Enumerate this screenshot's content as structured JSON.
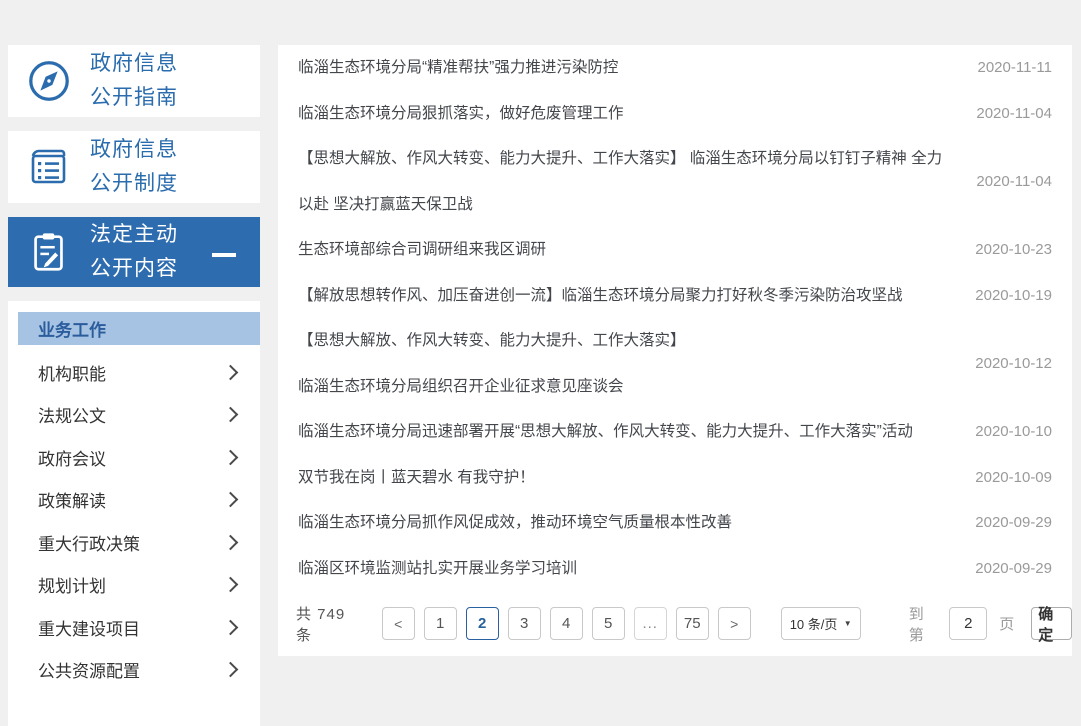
{
  "colors": {
    "accent_blue": "#2e6cb0",
    "sidebar_text_blue": "#2a6cad",
    "menu_highlight_bg": "#a6c3e3",
    "menu_highlight_text": "#2b5c9c",
    "title_text": "#43464b",
    "date_text": "#9a9a9a",
    "pager_active_blue": "#29609f",
    "page_background": "#f0f0f0"
  },
  "sidebar": {
    "cards": [
      {
        "label": "政府信息\n公开指南",
        "icon": "compass-icon"
      },
      {
        "label": "政府信息\n公开制度",
        "icon": "ledger-icon"
      },
      {
        "label": "法定主动\n公开内容",
        "icon": "clipboard-pencil-icon",
        "state_icon": "minus-icon"
      }
    ],
    "menu": {
      "items": [
        {
          "label": "业务工作",
          "active": true
        },
        {
          "label": "机构职能"
        },
        {
          "label": "法规公文"
        },
        {
          "label": "政府会议"
        },
        {
          "label": "政策解读"
        },
        {
          "label": "重大行政决策"
        },
        {
          "label": "规划计划"
        },
        {
          "label": "重大建设项目"
        },
        {
          "label": "公共资源配置"
        }
      ]
    }
  },
  "list": {
    "rows": [
      {
        "title": "临淄生态环境分局“精准帮扶”强力推进污染防控",
        "date": "2020-11-11"
      },
      {
        "title": "临淄生态环境分局狠抓落实，做好危废管理工作",
        "date": "2020-11-04"
      },
      {
        "title": "【思想大解放、作风大转变、能力大提升、工作大落实】 临淄生态环境分局以钉钉子精神 全力\n以赴 坚决打赢蓝天保卫战",
        "date": "2020-11-04"
      },
      {
        "title": "生态环境部综合司调研组来我区调研",
        "date": "2020-10-23"
      },
      {
        "title": "【解放思想转作风、加压奋进创一流】临淄生态环境分局聚力打好秋冬季污染防治攻坚战",
        "date": "2020-10-19"
      },
      {
        "title": "【思想大解放、作风大转变、能力大提升、工作大落实】\n临淄生态环境分局组织召开企业征求意见座谈会",
        "date": "2020-10-12"
      },
      {
        "title": "临淄生态环境分局迅速部署开展“思想大解放、作风大转变、能力大提升、工作大落实”活动",
        "date": "2020-10-10"
      },
      {
        "title": "双节我在岗丨蓝天碧水 有我守护！",
        "date": "2020-10-09"
      },
      {
        "title": "临淄生态环境分局抓作风促成效，推动环境空气质量根本性改善",
        "date": "2020-09-29"
      },
      {
        "title": "临淄区环境监测站扎实开展业务学习培训",
        "date": "2020-09-29"
      }
    ]
  },
  "pager": {
    "total_label": "共 749 条",
    "prev_label": "<",
    "next_label": ">",
    "pages": [
      "1",
      "2",
      "3",
      "4",
      "5",
      "...",
      "75"
    ],
    "active_page": "2",
    "page_size_label": "10 条/页",
    "page_size_caret": "▼",
    "goto_prefix": "到第",
    "goto_value": "2",
    "goto_suffix": "页",
    "confirm_label": "确定"
  }
}
